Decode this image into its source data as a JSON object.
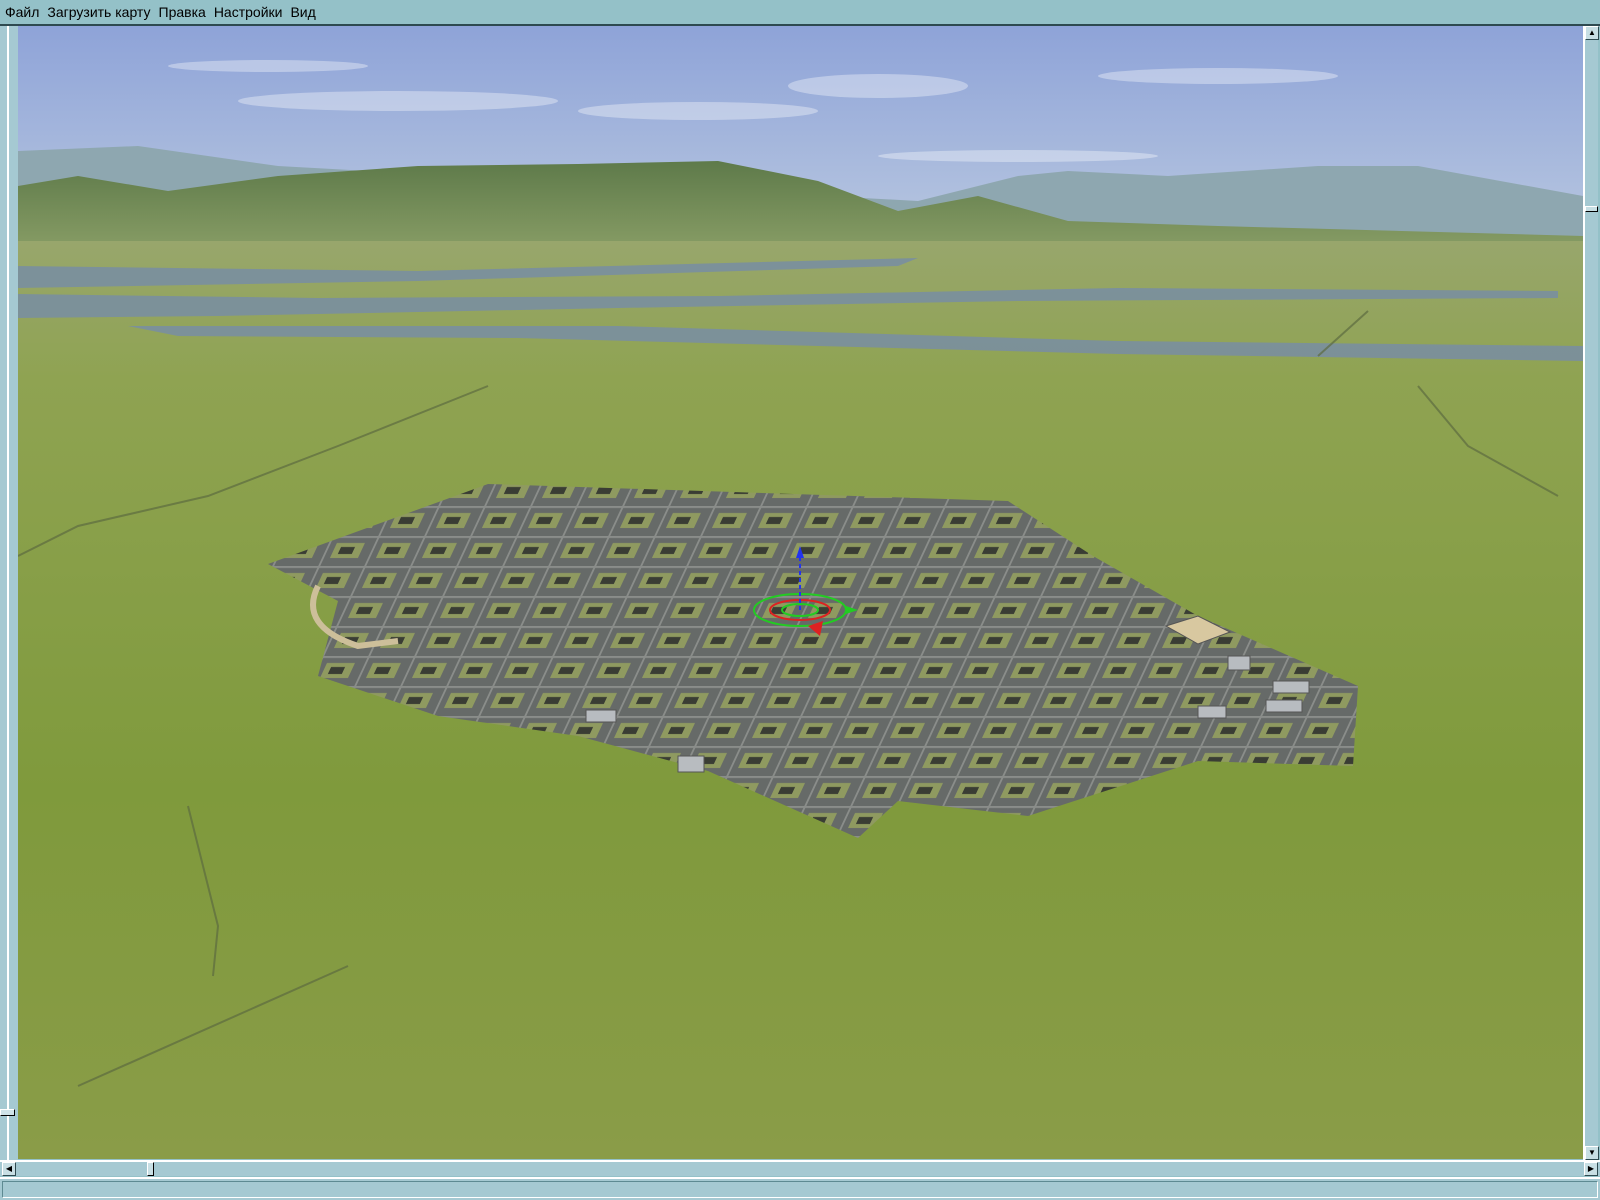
{
  "menu": {
    "items": [
      "Файл",
      "Загрузить карту",
      "Правка",
      "Настройки",
      "Вид"
    ]
  },
  "viewport": {
    "scene": "3d-terrain-editor-view",
    "colors": {
      "sky_top": "#8ea3d8",
      "sky_horizon": "#b9c8e0",
      "grass": "#8aa14a",
      "water": "#7a8fa0",
      "city": "#6b6f6c",
      "gizmo_ring": "#22cc22",
      "gizmo_arrow": "#dd2222",
      "gizmo_axis": "#2233ee"
    }
  },
  "scrollbars": {
    "vertical_position": 0.12,
    "horizontal_position": 0.09
  },
  "statusbar": {
    "text": ""
  }
}
